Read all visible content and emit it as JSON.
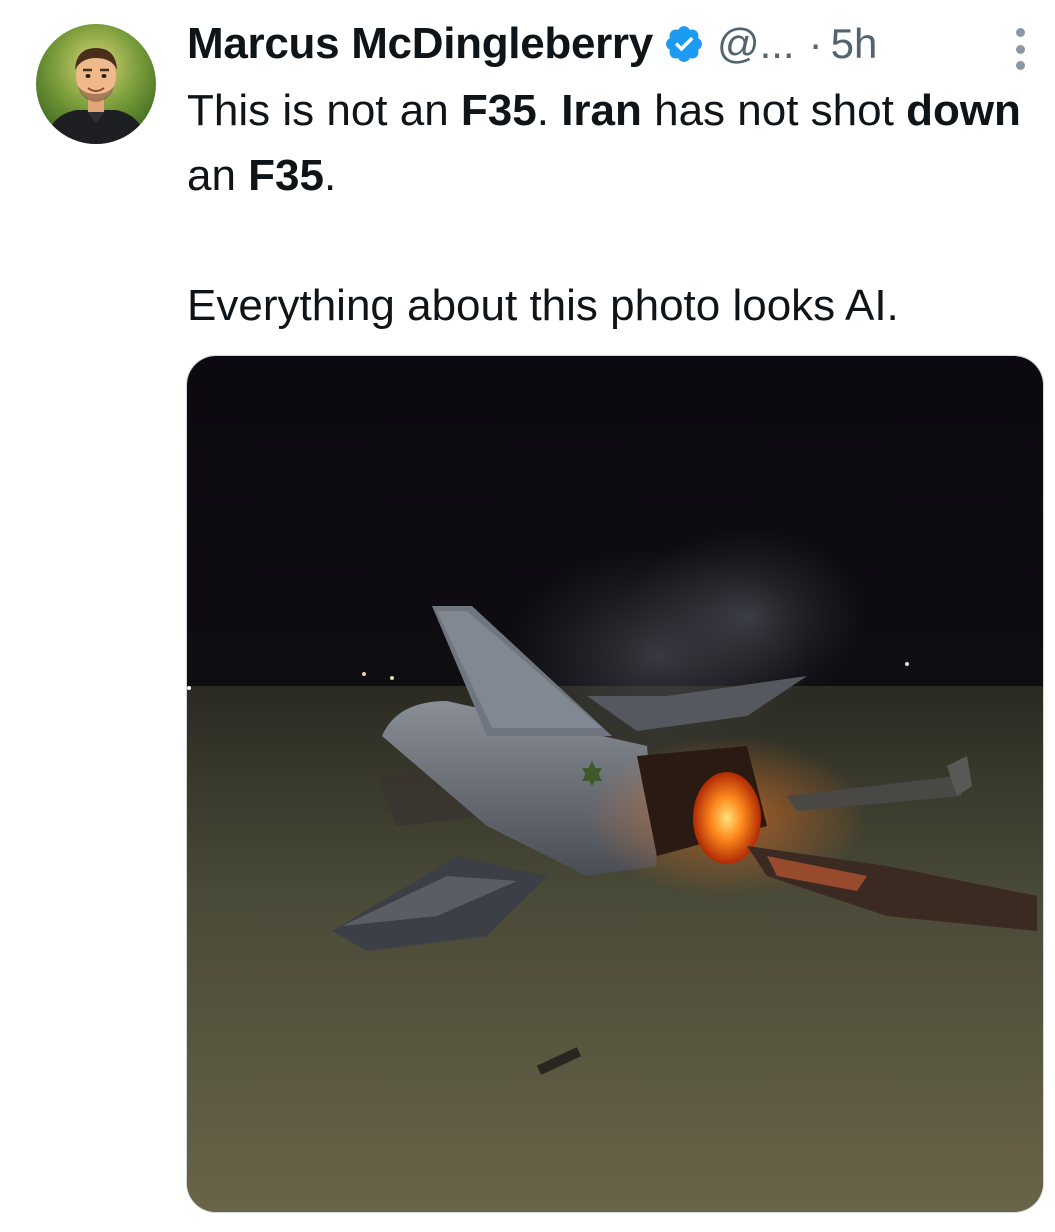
{
  "author": {
    "display_name": "Marcus McDingleberry",
    "handle": "@...",
    "verified_icon": "verified-badge-icon",
    "avatar_icon": "cartoon-man-avatar"
  },
  "meta": {
    "separator": "·",
    "time": "5h"
  },
  "tweet": {
    "p1_s1": "This is not an ",
    "p1_b1": "F35",
    "p1_s2": ". ",
    "p1_b2": "Iran",
    "p1_s3": " has not shot ",
    "p1_b3": "down",
    "p1_s4": " an ",
    "p1_b4": "F35",
    "p1_s5": ".",
    "p2": "Everything about this photo looks AI."
  },
  "media": {
    "alt_icon": "burning-fighter-jet-photo"
  },
  "colors": {
    "text_primary": "#0f1419",
    "text_secondary": "#536471",
    "verified_blue": "#1d9bf0"
  }
}
